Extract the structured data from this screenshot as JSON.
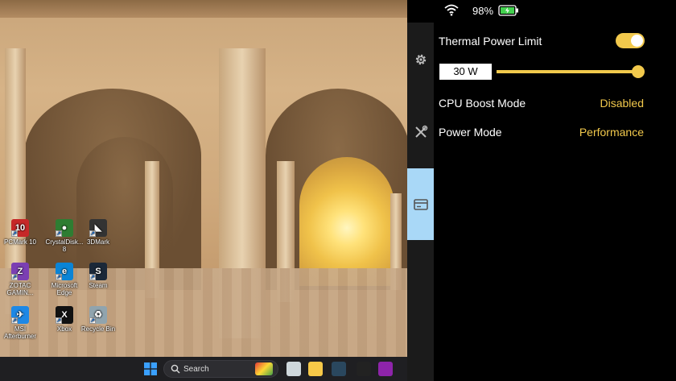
{
  "desktop": {
    "icons": [
      {
        "label": "PCMark 10",
        "icon": "pcmark-icon",
        "color": "#c62828",
        "glyph": "10"
      },
      {
        "label": "CrystalDisk...\n8",
        "icon": "crystaldisk-icon",
        "color": "#2e7d32",
        "glyph": "●"
      },
      {
        "label": "3DMark",
        "icon": "3dmark-icon",
        "color": "#333333",
        "glyph": "◣"
      },
      {
        "label": "ZOTAC\nGAMIN...",
        "icon": "zotac-icon",
        "color": "#7b3fb3",
        "glyph": "Z"
      },
      {
        "label": "Microsoft\nEdge",
        "icon": "edge-icon",
        "color": "#0a84d6",
        "glyph": "e"
      },
      {
        "label": "Steam",
        "icon": "steam-icon",
        "color": "#1b2838",
        "glyph": "S"
      },
      {
        "label": "MSI\nAfterburner",
        "icon": "afterburner-icon",
        "color": "#1e88e5",
        "glyph": "✈"
      },
      {
        "label": "Xbox",
        "icon": "xbox-icon",
        "color": "#111111",
        "glyph": "X"
      },
      {
        "label": "Recycle Bin",
        "icon": "recycle-bin-icon",
        "color": "#90a4ae",
        "glyph": "♻"
      }
    ]
  },
  "taskbar": {
    "search_placeholder": "Search",
    "apps": [
      {
        "icon": "windows-start-icon",
        "color": "#3aa0ff"
      },
      {
        "icon": "task-view-icon",
        "color": "#cfd8dc"
      },
      {
        "icon": "file-explorer-icon",
        "color": "#f7c948"
      },
      {
        "icon": "steam-icon",
        "color": "#2a475e"
      },
      {
        "icon": "epic-games-icon",
        "color": "#222222"
      },
      {
        "icon": "zotac-hub-icon",
        "color": "#8e24aa"
      },
      {
        "icon": "xbox-icon",
        "color": "#107c10"
      }
    ]
  },
  "status": {
    "battery_percent": "98%",
    "wifi_icon": "wifi-icon",
    "battery_icon": "battery-charging-icon"
  },
  "rail": {
    "items": [
      {
        "icon": "gear-icon",
        "active": false
      },
      {
        "icon": "wrench-screwdriver-icon",
        "active": false
      },
      {
        "icon": "card-icon",
        "active": true
      }
    ]
  },
  "panel": {
    "thermal_power_limit": {
      "label": "Thermal Power Limit",
      "enabled": true,
      "value_text": "30 W",
      "slider_fraction": 1.0
    },
    "cpu_boost": {
      "label": "CPU Boost Mode",
      "value": "Disabled"
    },
    "power_mode": {
      "label": "Power Mode",
      "value": "Performance"
    }
  },
  "colors": {
    "accent": "#f2c94c",
    "panel_bg": "#000000",
    "rail_bg": "#1b1b1b",
    "rail_active": "#a9d8f7"
  }
}
